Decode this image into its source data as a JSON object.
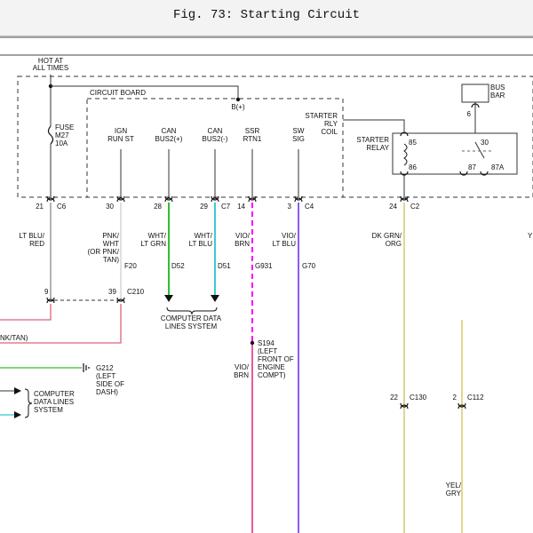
{
  "figure_title": "Fig. 73: Starting Circuit",
  "colors": {
    "line": "#333333",
    "lt_blu_red": "#8a8a8a",
    "pnk_wht": "#cfcfcf",
    "pink_bottom": "#e0607a",
    "wht_lt_grn": "#2fbf2f",
    "wht_lt_blu": "#3fc7d6",
    "vio_brn": "#e7207a",
    "vio_lt_blu": "#8a5cf0",
    "dk_grn_org": "#d8c86a",
    "yel_gry": "#d8c86a",
    "magenta_dash": "#ff00ff"
  },
  "hot_label": [
    "HOT AT",
    "ALL TIMES"
  ],
  "fuse": {
    "lines": [
      "FUSE",
      "M27",
      "10A"
    ]
  },
  "circuit_board": {
    "label": "CIRCUIT BOARD",
    "bplus": "B(+)"
  },
  "starter_rly_coil": [
    "STARTER",
    "RLY",
    "COIL"
  ],
  "bus_bar": [
    "BUS",
    "BAR"
  ],
  "bus_bar_pin": "6",
  "starter_relay": {
    "label": [
      "STARTER",
      "RELAY"
    ],
    "pins": [
      "85",
      "86",
      "30",
      "87",
      "87A"
    ]
  },
  "module_pins": [
    {
      "label": [
        "IGN",
        "RUN ST"
      ]
    },
    {
      "label": [
        "CAN",
        "BUS2(+)"
      ]
    },
    {
      "label": [
        "CAN",
        "BUS2(-)"
      ]
    },
    {
      "label": [
        "SSR",
        "RTN1"
      ]
    },
    {
      "label": [
        "SW",
        "SIG"
      ]
    }
  ],
  "connector_pins": [
    {
      "pin": "21",
      "conn": "C6"
    },
    {
      "pin": "30",
      "conn": ""
    },
    {
      "pin": "28",
      "conn": ""
    },
    {
      "pin": "29",
      "conn": "C7"
    },
    {
      "pin": "14",
      "conn": ""
    },
    {
      "pin": "3",
      "conn": "C4"
    },
    {
      "pin": "24",
      "conn": "C2"
    }
  ],
  "wires": [
    {
      "color": [
        "LT BLU/",
        "RED"
      ],
      "code": ""
    },
    {
      "color": [
        "PNK/",
        "WHT",
        "(OR PNK/",
        "TAN)"
      ],
      "code": "F20"
    },
    {
      "color": [
        "WHT/",
        "LT GRN"
      ],
      "code": "D52"
    },
    {
      "color": [
        "WHT/",
        "LT BLU"
      ],
      "code": "D51"
    },
    {
      "color": [
        "VIO/",
        "BRN"
      ],
      "code": "G931"
    },
    {
      "color": [
        "VIO/",
        "LT BLU"
      ],
      "code": "G70"
    },
    {
      "color": [
        "DK GRN/",
        "ORG"
      ],
      "code": ""
    },
    {
      "color": [
        "Y"
      ],
      "code": ""
    }
  ],
  "c210": {
    "left_pin": "9",
    "right_pin": "39",
    "conn": "C210"
  },
  "pnk_tan_partial": "NK/TAN)",
  "computer_data_lines_1": [
    "COMPUTER DATA",
    "LINES SYSTEM"
  ],
  "computer_data_lines_2": [
    "COMPUTER",
    "DATA LINES",
    "SYSTEM"
  ],
  "g212": [
    "G212",
    "(LEFT",
    "SIDE OF",
    "DASH)"
  ],
  "s194": [
    "S194",
    "(LEFT",
    "FRONT OF",
    "ENGINE",
    "COMPT)"
  ],
  "vio_brn_lower": [
    "VIO/",
    "BRN"
  ],
  "c130": {
    "pin": "22",
    "conn": "C130"
  },
  "c112": {
    "pin": "2",
    "conn": "C112"
  },
  "yel_gry": [
    "YEL/",
    "GRY"
  ]
}
